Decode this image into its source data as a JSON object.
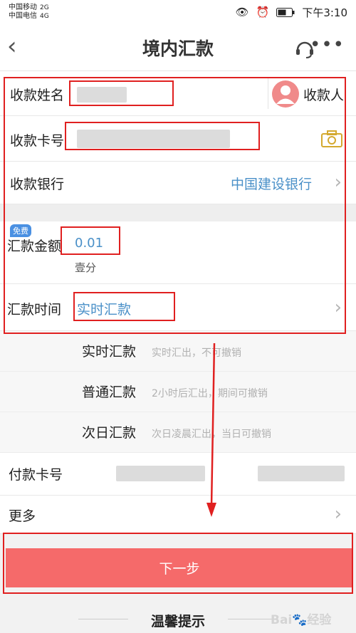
{
  "status": {
    "carrier1": "中国移动",
    "carrier2": "中国电信",
    "net1": "2G",
    "net2": "4G",
    "time": "下午3:10"
  },
  "nav": {
    "title": "境内汇款"
  },
  "form": {
    "name_label": "收款姓名",
    "payee_label": "收款人",
    "card_label": "收款卡号",
    "bank_label": "收款银行",
    "bank_value": "中国建设银行",
    "free_badge": "免费",
    "amount_label": "汇款金额",
    "amount_value": "0.01",
    "amount_caps": "壹分",
    "time_label": "汇款时间",
    "time_value": "实时汇款"
  },
  "options": [
    {
      "name": "实时汇款",
      "desc": "实时汇出，不可撤销"
    },
    {
      "name": "普通汇款",
      "desc": "2小时后汇出，期间可撤销"
    },
    {
      "name": "次日汇款",
      "desc": "次日凌晨汇出，当日可撤销"
    }
  ],
  "pay": {
    "label": "付款卡号"
  },
  "more": {
    "label": "更多"
  },
  "actions": {
    "next": "下一步"
  },
  "tips": {
    "title": "温馨提示"
  },
  "colors": {
    "accent": "#4a90c8",
    "button": "#f56a6a",
    "annotation": "#e02020"
  }
}
